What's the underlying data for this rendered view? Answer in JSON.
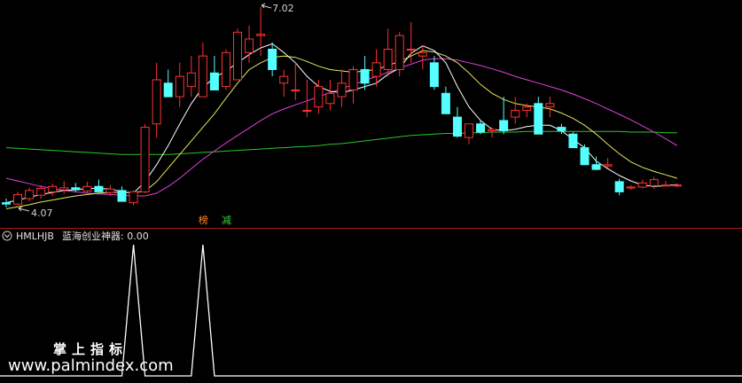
{
  "colors": {
    "background": "#000000",
    "up": "#ff3232",
    "down": "#54ffff",
    "ma_white": "#ffffff",
    "ma_yellow": "#e8e85a",
    "ma_magenta": "#e040e0",
    "ma_green": "#28c828",
    "divider": "#b01818",
    "indicator": "#ffffff",
    "tag_orange": "#ff8c28",
    "tag_green": "#3cd23c",
    "label_text": "#d0d0d0",
    "title_text": "#e0e0e0"
  },
  "main_panel": {
    "price_high": {
      "text": "7.02",
      "value": 7.02
    },
    "price_low": {
      "text": "4.07",
      "value": 4.07
    },
    "markers": [
      {
        "label": "榜",
        "candle_index": 17
      },
      {
        "label": "减",
        "candle_index": 19
      }
    ]
  },
  "indicator_panel": {
    "toggle_icon": "chevron-down-icon",
    "name": "HMLHJB",
    "title": "蓝海创业神器: 0.00"
  },
  "watermark": {
    "cn": "掌上指标",
    "url": "www.palmindex.com"
  },
  "chart_data": {
    "type": "candlestick",
    "price_range": [
      4.07,
      7.02
    ],
    "ohlc": [
      [
        4.14,
        4.2,
        4.07,
        4.12
      ],
      [
        4.12,
        4.3,
        4.1,
        4.26
      ],
      [
        4.2,
        4.36,
        4.16,
        4.32
      ],
      [
        4.25,
        4.4,
        4.2,
        4.35
      ],
      [
        4.3,
        4.42,
        4.24,
        4.38
      ],
      [
        4.33,
        4.46,
        4.27,
        4.36
      ],
      [
        4.36,
        4.43,
        4.3,
        4.33
      ],
      [
        4.31,
        4.45,
        4.28,
        4.38
      ],
      [
        4.38,
        4.48,
        4.33,
        4.3
      ],
      [
        4.29,
        4.4,
        4.24,
        4.34
      ],
      [
        4.32,
        4.38,
        4.22,
        4.16
      ],
      [
        4.14,
        4.32,
        4.1,
        4.3
      ],
      [
        4.3,
        5.3,
        4.28,
        5.25
      ],
      [
        5.3,
        6.2,
        5.1,
        5.95
      ],
      [
        5.9,
        6.1,
        5.7,
        5.7
      ],
      [
        5.7,
        6.2,
        5.55,
        6.0
      ],
      [
        5.85,
        6.3,
        5.7,
        6.05
      ],
      [
        5.7,
        6.5,
        5.7,
        6.3
      ],
      [
        6.05,
        6.3,
        5.85,
        5.8
      ],
      [
        5.85,
        6.4,
        5.8,
        6.35
      ],
      [
        5.95,
        6.7,
        5.95,
        6.65
      ],
      [
        6.35,
        6.75,
        6.2,
        6.55
      ],
      [
        6.6,
        7.02,
        6.3,
        6.62
      ],
      [
        6.4,
        6.5,
        6.0,
        6.1
      ],
      [
        5.9,
        6.1,
        5.7,
        6.0
      ],
      [
        5.8,
        6.2,
        5.65,
        5.8
      ],
      [
        5.5,
        5.95,
        5.4,
        5.5
      ],
      [
        5.55,
        5.95,
        5.45,
        5.85
      ],
      [
        5.6,
        5.95,
        5.5,
        5.75
      ],
      [
        5.7,
        6.1,
        5.55,
        5.9
      ],
      [
        5.8,
        6.15,
        5.6,
        6.1
      ],
      [
        6.1,
        6.3,
        5.8,
        5.9
      ],
      [
        6.0,
        6.4,
        5.85,
        6.2
      ],
      [
        6.1,
        6.7,
        6.0,
        6.4
      ],
      [
        6.1,
        6.65,
        6.0,
        6.6
      ],
      [
        6.4,
        6.8,
        6.2,
        6.4
      ],
      [
        6.3,
        6.45,
        6.1,
        6.35
      ],
      [
        6.2,
        6.3,
        5.8,
        5.85
      ],
      [
        5.75,
        5.85,
        5.45,
        5.45
      ],
      [
        5.4,
        5.55,
        5.1,
        5.12
      ],
      [
        5.1,
        5.3,
        5.0,
        5.3
      ],
      [
        5.3,
        5.35,
        5.15,
        5.18
      ],
      [
        5.2,
        5.25,
        5.1,
        5.22
      ],
      [
        5.35,
        5.7,
        5.15,
        5.2
      ],
      [
        5.4,
        5.7,
        5.3,
        5.5
      ],
      [
        5.5,
        5.6,
        5.4,
        5.55
      ],
      [
        5.6,
        5.7,
        5.15,
        5.15
      ],
      [
        5.55,
        5.7,
        5.4,
        5.6
      ],
      [
        5.25,
        5.3,
        5.15,
        5.2
      ],
      [
        5.15,
        5.18,
        4.95,
        4.95
      ],
      [
        4.95,
        5.0,
        4.7,
        4.7
      ],
      [
        4.7,
        4.82,
        4.62,
        4.63
      ],
      [
        4.68,
        4.8,
        4.65,
        4.7
      ],
      [
        4.45,
        4.49,
        4.25,
        4.3
      ],
      [
        4.36,
        4.4,
        4.33,
        4.37
      ],
      [
        4.37,
        4.48,
        4.35,
        4.43
      ],
      [
        4.39,
        4.52,
        4.34,
        4.48
      ],
      [
        4.4,
        4.46,
        4.38,
        4.4
      ],
      [
        4.4,
        4.42,
        4.37,
        4.4
      ]
    ],
    "ma_white": [
      4.14,
      4.18,
      4.22,
      4.26,
      4.29,
      4.32,
      4.33,
      4.35,
      4.35,
      4.34,
      4.3,
      4.28,
      4.45,
      4.7,
      4.98,
      5.3,
      5.6,
      5.84,
      5.98,
      6.08,
      6.2,
      6.32,
      6.42,
      6.48,
      6.35,
      6.2,
      6.0,
      5.85,
      5.78,
      5.76,
      5.8,
      5.85,
      5.9,
      6.03,
      6.12,
      6.34,
      6.45,
      6.38,
      6.2,
      5.85,
      5.55,
      5.35,
      5.22,
      5.2,
      5.22,
      5.26,
      5.28,
      5.28,
      5.2,
      5.07,
      4.95,
      4.75,
      4.64,
      4.54,
      4.46,
      4.4,
      4.38,
      4.39,
      4.41
    ],
    "ma_yellow": [
      4.05,
      4.08,
      4.11,
      4.15,
      4.18,
      4.21,
      4.24,
      4.26,
      4.28,
      4.29,
      4.29,
      4.29,
      4.31,
      4.45,
      4.65,
      4.85,
      5.05,
      5.25,
      5.45,
      5.68,
      5.9,
      6.1,
      6.2,
      6.28,
      6.3,
      6.28,
      6.22,
      6.15,
      6.1,
      6.08,
      6.06,
      6.08,
      6.1,
      6.16,
      6.22,
      6.3,
      6.38,
      6.36,
      6.3,
      6.2,
      6.05,
      5.88,
      5.75,
      5.66,
      5.6,
      5.57,
      5.55,
      5.52,
      5.46,
      5.38,
      5.28,
      5.15,
      5.0,
      4.86,
      4.74,
      4.66,
      4.6,
      4.55,
      4.5
    ],
    "ma_magenta": [
      4.5,
      4.46,
      4.42,
      4.38,
      4.35,
      4.32,
      4.3,
      4.28,
      4.27,
      4.26,
      4.25,
      4.24,
      4.24,
      4.28,
      4.38,
      4.5,
      4.64,
      4.78,
      4.9,
      5.02,
      5.13,
      5.24,
      5.35,
      5.45,
      5.52,
      5.58,
      5.64,
      5.7,
      5.76,
      5.82,
      5.88,
      5.94,
      6.0,
      6.06,
      6.12,
      6.18,
      6.24,
      6.26,
      6.26,
      6.24,
      6.2,
      6.16,
      6.11,
      6.06,
      6.0,
      5.95,
      5.9,
      5.85,
      5.8,
      5.74,
      5.67,
      5.6,
      5.52,
      5.44,
      5.36,
      5.27,
      5.18,
      5.08,
      4.98
    ],
    "ma_green": [
      4.95,
      4.94,
      4.93,
      4.92,
      4.91,
      4.9,
      4.89,
      4.88,
      4.87,
      4.86,
      4.85,
      4.85,
      4.85,
      4.85,
      4.85,
      4.86,
      4.87,
      4.88,
      4.89,
      4.9,
      4.91,
      4.92,
      4.93,
      4.94,
      4.95,
      4.96,
      4.97,
      4.98,
      5.0,
      5.01,
      5.03,
      5.05,
      5.07,
      5.09,
      5.11,
      5.13,
      5.14,
      5.15,
      5.16,
      5.16,
      5.17,
      5.17,
      5.18,
      5.18,
      5.18,
      5.19,
      5.19,
      5.19,
      5.19,
      5.19,
      5.19,
      5.19,
      5.19,
      5.19,
      5.18,
      5.18,
      5.18,
      5.17,
      5.17
    ],
    "indicator": [
      0,
      0,
      0,
      0,
      0,
      0,
      0,
      0,
      0,
      0,
      0,
      0,
      0,
      0,
      0,
      0,
      0,
      0,
      0,
      0,
      0,
      0,
      0,
      0,
      0,
      0,
      0,
      0,
      0,
      0,
      0,
      0,
      0,
      0,
      0,
      0,
      0,
      0,
      0,
      0,
      0,
      0,
      0,
      0,
      0,
      0,
      0,
      0,
      0,
      0,
      0,
      0,
      0,
      0,
      0,
      0,
      0,
      0,
      0
    ],
    "indicator_spikes": [
      {
        "index": 11,
        "value": 1
      },
      {
        "index": 17,
        "value": 1
      }
    ],
    "indicator_range": [
      0,
      1
    ]
  }
}
